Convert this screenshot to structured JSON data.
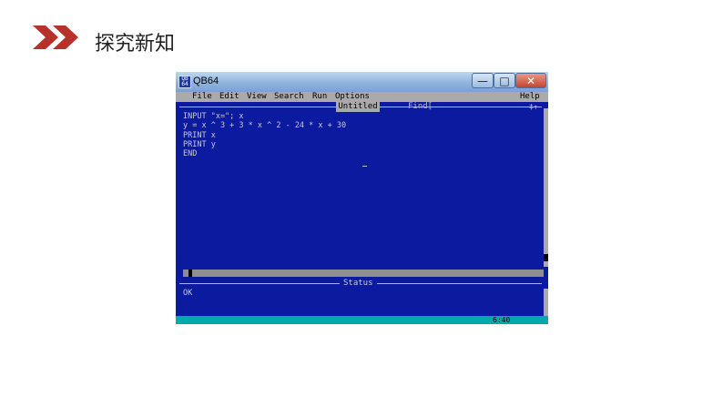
{
  "slide": {
    "title": "探究新知"
  },
  "window": {
    "title": "QB64",
    "icon_text": "QB 64",
    "buttons": {
      "minimize": "—",
      "maximize": "□",
      "close": "✕"
    }
  },
  "menu": {
    "items": [
      {
        "label": "File"
      },
      {
        "label": "Edit"
      },
      {
        "label": "View"
      },
      {
        "label": "Search"
      },
      {
        "label": "Run"
      },
      {
        "label": "Options"
      }
    ],
    "help": "Help"
  },
  "editor": {
    "doc_title": "Untitled",
    "find_label": "Find[",
    "find_controls": "‡↑",
    "code": "INPUT \"x=\"; x\ny = x ^ 3 + 3 * x ^ 2 - 24 * x + 30\nPRINT x\nPRINT y\nEND"
  },
  "status": {
    "label": "Status",
    "text": "OK"
  },
  "bottom": {
    "cursor_pos": "6:40"
  },
  "colors": {
    "editor_bg": "#0b1a9e",
    "menu_bg": "#aaaaaa",
    "bottom_bar": "#00aaaa",
    "chevron": "#b8302a"
  }
}
